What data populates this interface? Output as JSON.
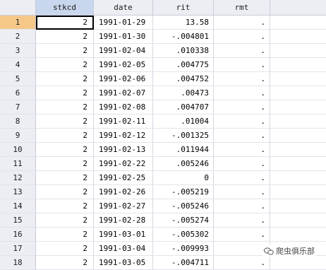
{
  "headers": [
    "stkcd",
    "date",
    "rit",
    "rmt"
  ],
  "rows": [
    {
      "n": "1",
      "stkcd": "2",
      "date": "1991-01-29",
      "rit": "13.58",
      "rmt": "."
    },
    {
      "n": "2",
      "stkcd": "2",
      "date": "1991-01-30",
      "rit": "-.004801",
      "rmt": "."
    },
    {
      "n": "3",
      "stkcd": "2",
      "date": "1991-02-04",
      "rit": ".010338",
      "rmt": "."
    },
    {
      "n": "4",
      "stkcd": "2",
      "date": "1991-02-05",
      "rit": ".004775",
      "rmt": "."
    },
    {
      "n": "5",
      "stkcd": "2",
      "date": "1991-02-06",
      "rit": ".004752",
      "rmt": "."
    },
    {
      "n": "6",
      "stkcd": "2",
      "date": "1991-02-07",
      "rit": ".00473",
      "rmt": "."
    },
    {
      "n": "7",
      "stkcd": "2",
      "date": "1991-02-08",
      "rit": ".004707",
      "rmt": "."
    },
    {
      "n": "8",
      "stkcd": "2",
      "date": "1991-02-11",
      "rit": ".01004",
      "rmt": "."
    },
    {
      "n": "9",
      "stkcd": "2",
      "date": "1991-02-12",
      "rit": "-.001325",
      "rmt": "."
    },
    {
      "n": "10",
      "stkcd": "2",
      "date": "1991-02-13",
      "rit": ".011944",
      "rmt": "."
    },
    {
      "n": "11",
      "stkcd": "2",
      "date": "1991-02-22",
      "rit": ".005246",
      "rmt": "."
    },
    {
      "n": "12",
      "stkcd": "2",
      "date": "1991-02-25",
      "rit": "0",
      "rmt": "."
    },
    {
      "n": "13",
      "stkcd": "2",
      "date": "1991-02-26",
      "rit": "-.005219",
      "rmt": "."
    },
    {
      "n": "14",
      "stkcd": "2",
      "date": "1991-02-27",
      "rit": "-.005246",
      "rmt": "."
    },
    {
      "n": "15",
      "stkcd": "2",
      "date": "1991-02-28",
      "rit": "-.005274",
      "rmt": "."
    },
    {
      "n": "16",
      "stkcd": "2",
      "date": "1991-03-01",
      "rit": "-.005302",
      "rmt": "."
    },
    {
      "n": "17",
      "stkcd": "2",
      "date": "1991-03-04",
      "rit": "-.009993",
      "rmt": "."
    },
    {
      "n": "18",
      "stkcd": "2",
      "date": "1991-03-05",
      "rit": "-.004711",
      "rmt": "."
    }
  ],
  "watermark": "爬虫俱乐部",
  "colors": {
    "header_bg": "#eceef4",
    "active_row": "#f5c88a",
    "active_header": "#c9d7ee"
  },
  "icons": {
    "watermark": "wechat-icon"
  }
}
